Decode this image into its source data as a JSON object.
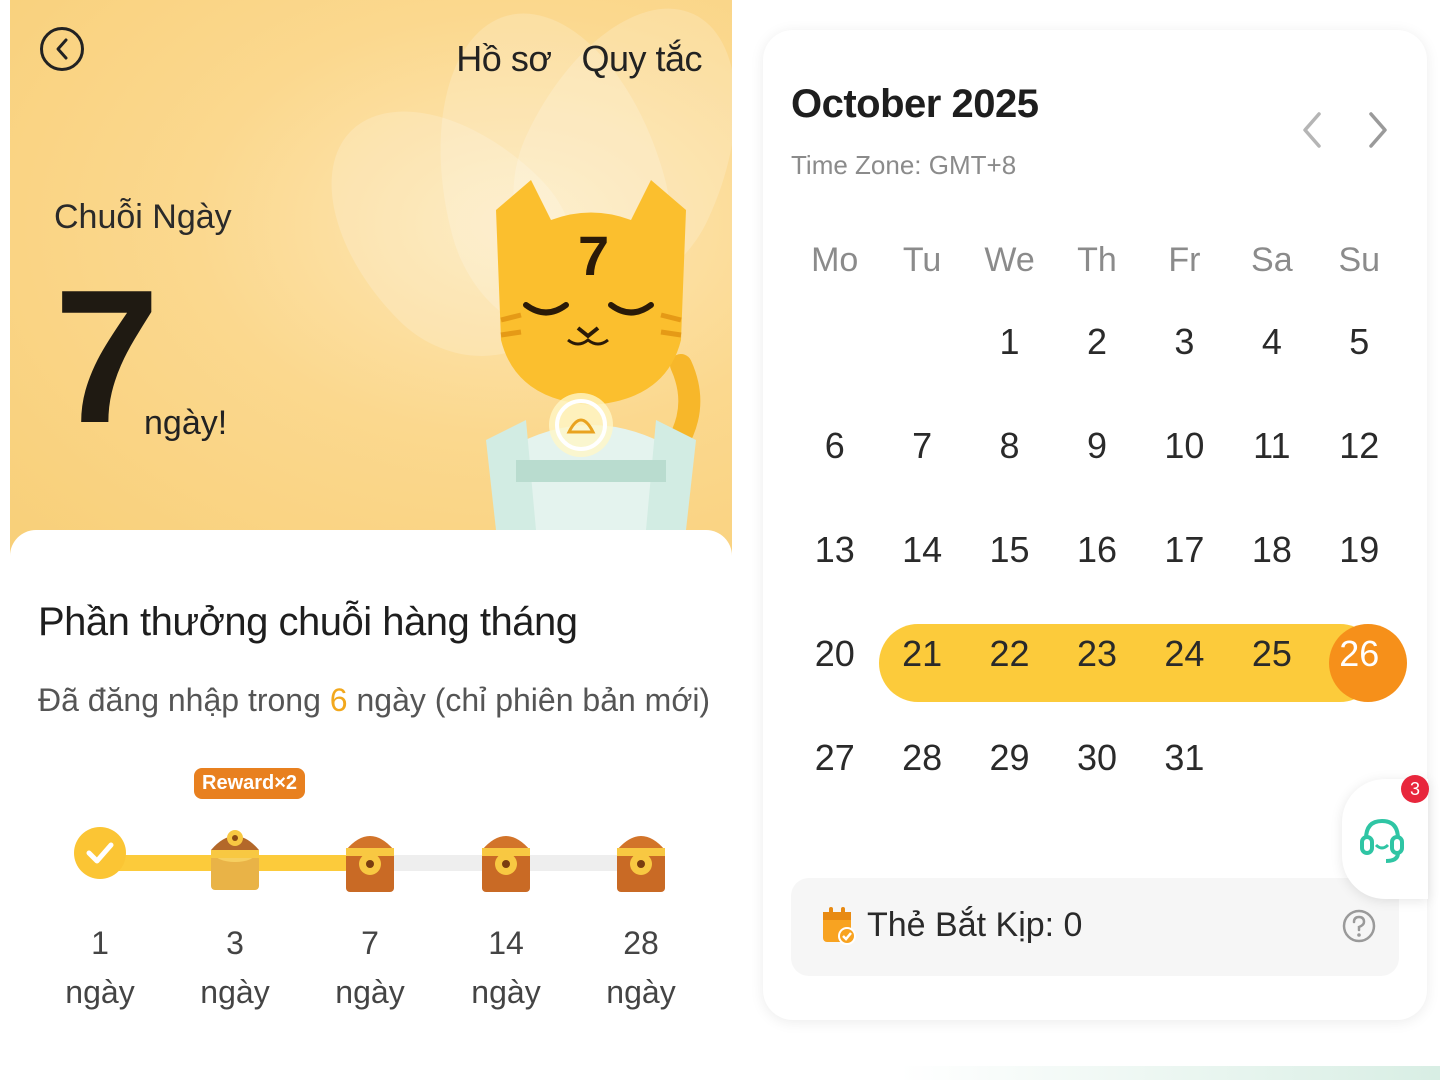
{
  "header": {
    "back_icon": "chevron-left-icon",
    "links": [
      "Hồ sơ",
      "Quy tắc"
    ]
  },
  "streak": {
    "label": "Chuỗi Ngày",
    "count": "7",
    "unit": "ngày!",
    "mascot_number": "7"
  },
  "monthly_reward": {
    "title": "Phần thưởng chuỗi hàng tháng",
    "subtitle_prefix": "Đã đăng nhập trong ",
    "days_logged": "6",
    "subtitle_suffix": " ngày (chỉ phiên bản mới)",
    "badge": "Reward×2",
    "progress_fraction": 0.45,
    "milestones": [
      {
        "days": "1",
        "unit": "ngày",
        "status": "done"
      },
      {
        "days": "3",
        "unit": "ngày",
        "status": "open-chest"
      },
      {
        "days": "7",
        "unit": "ngày",
        "status": "chest"
      },
      {
        "days": "14",
        "unit": "ngày",
        "status": "chest"
      },
      {
        "days": "28",
        "unit": "ngày",
        "status": "chest"
      }
    ]
  },
  "calendar": {
    "title": "October 2025",
    "timezone": "Time Zone: GMT+8",
    "weekdays": [
      "Mo",
      "Tu",
      "We",
      "Th",
      "Fr",
      "Sa",
      "Su"
    ],
    "weeks": [
      [
        "",
        "",
        "1",
        "2",
        "3",
        "4",
        "5"
      ],
      [
        "6",
        "7",
        "8",
        "9",
        "10",
        "11",
        "12"
      ],
      [
        "13",
        "14",
        "15",
        "16",
        "17",
        "18",
        "19"
      ],
      [
        "20",
        "21",
        "22",
        "23",
        "24",
        "25",
        "26"
      ],
      [
        "27",
        "28",
        "29",
        "30",
        "31",
        "",
        ""
      ]
    ],
    "streak_days": [
      "21",
      "22",
      "23",
      "24",
      "25",
      "26"
    ],
    "today": "26",
    "colors": {
      "streak": "#fccb3b",
      "today": "#f6901a"
    }
  },
  "catch_up": {
    "label": "Thẻ Bắt Kịp: ",
    "value": "0",
    "icon": "calendar-check-icon"
  },
  "support": {
    "icon": "headset-icon",
    "notification_count": "3"
  }
}
